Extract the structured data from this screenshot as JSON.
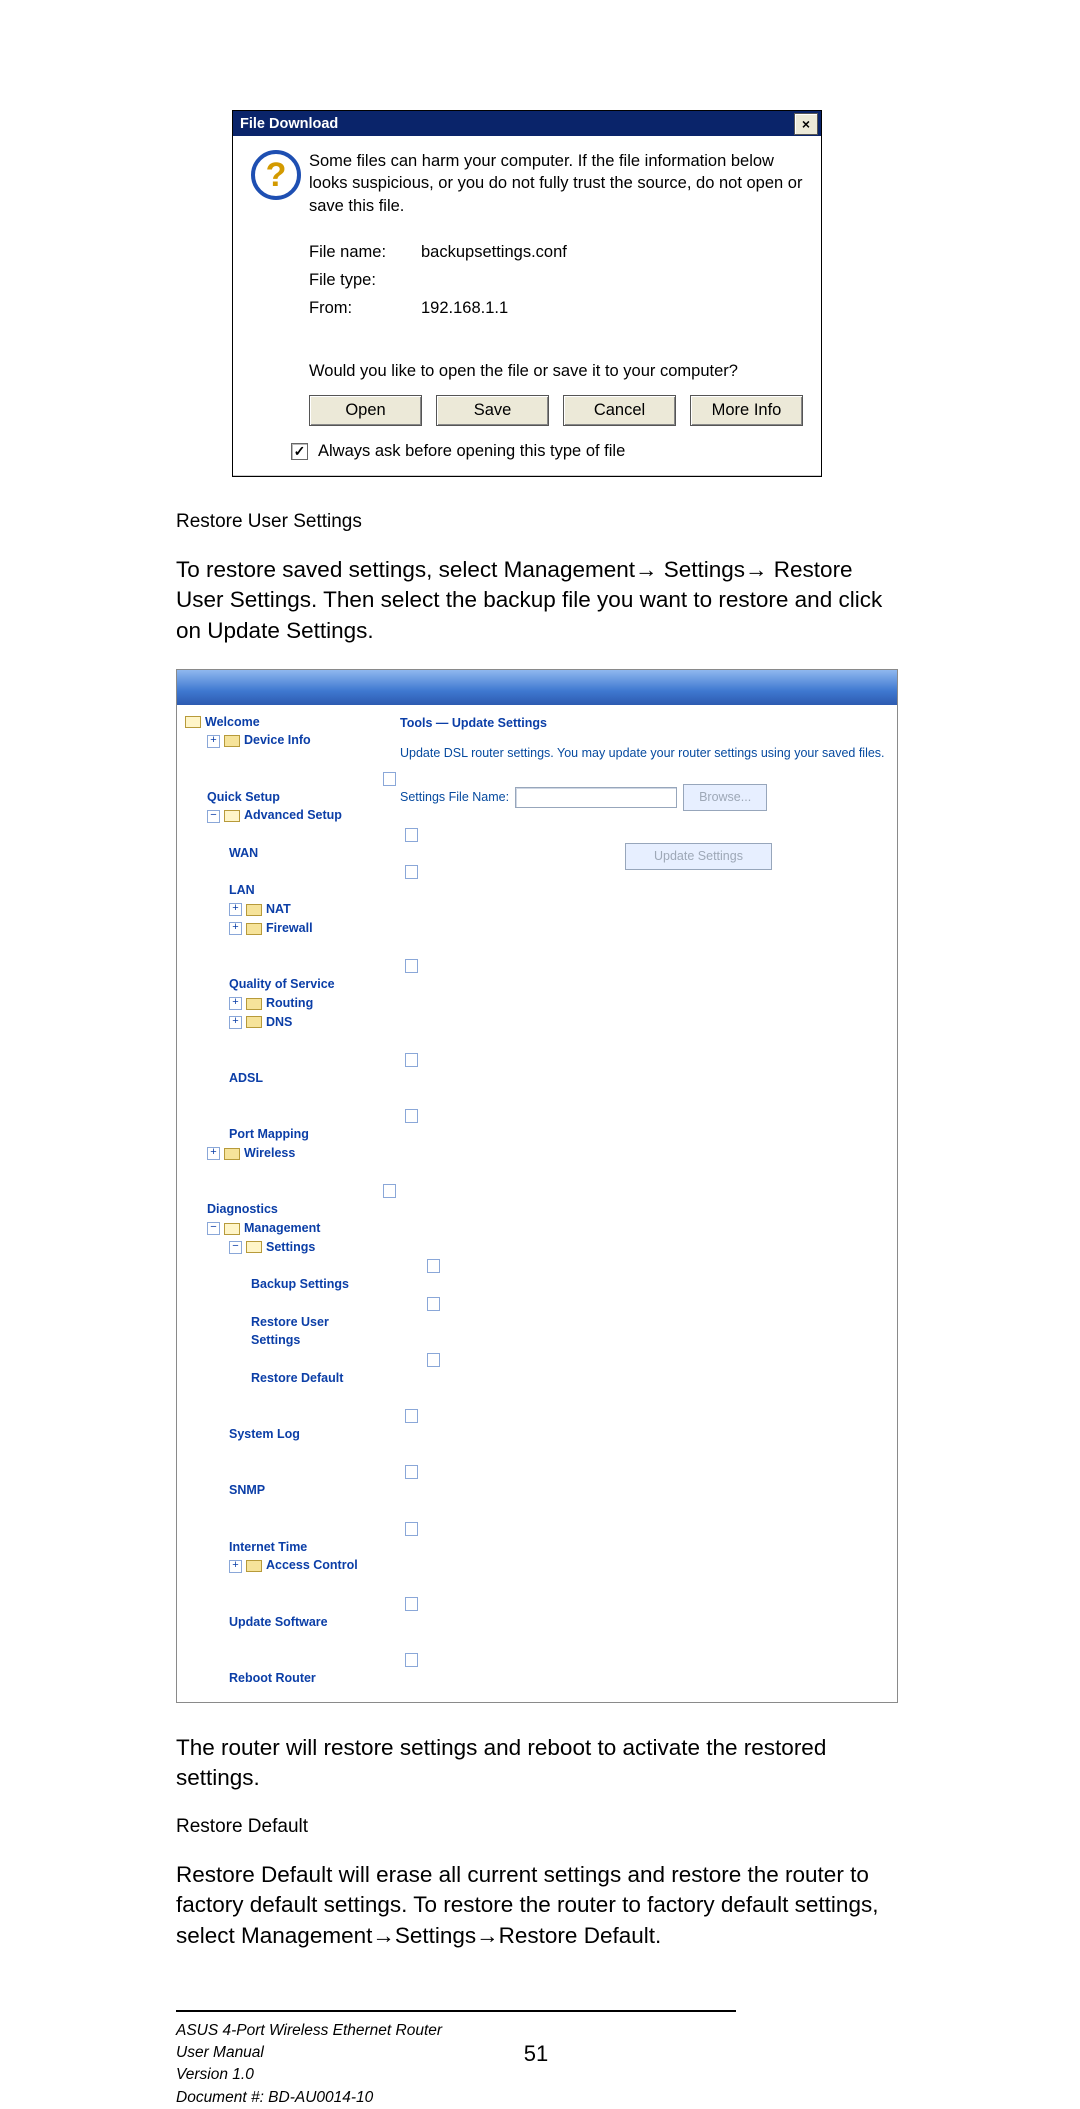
{
  "dialog": {
    "title": "File Download",
    "warning": "Some files can harm your computer. If the file information below looks suspicious, or you do not fully trust the source, do not open or save this file.",
    "filename_label": "File name:",
    "filename_value": "backupsettings.conf",
    "filetype_label": "File type:",
    "filetype_value": "",
    "from_label": "From:",
    "from_value": "192.168.1.1",
    "question": "Would you like to open the file or save it to your computer?",
    "btn_open": "Open",
    "btn_save": "Save",
    "btn_cancel": "Cancel",
    "btn_more": "More Info",
    "checkbox_label": "Always ask before opening this type of file"
  },
  "doc": {
    "restore_user_heading": "Restore User Settings",
    "restore_user_body_1": "To restore saved settings, select Management→ Settings→ Restore User Settings.  Then select the backup file you want to restore and click on ",
    "restore_user_body_2_bold": "Update Settings",
    "restore_user_body_3": ".",
    "after_router_body": "The router will restore settings and reboot to activate the restored settings.",
    "restore_default_heading": "Restore Default",
    "restore_default_body": "Restore Default will erase all current settings and restore the router to factory default settings. To restore the router to factory default settings, select Management→Settings→Restore Default.",
    "footer_line1": "ASUS 4-Port Wireless Ethernet Router",
    "footer_line2": "User Manual",
    "footer_line3": "Version 1.0",
    "footer_line4": "Document #:  BD-AU0014-10",
    "page_number": "51"
  },
  "router": {
    "title": "Tools — Update Settings",
    "desc": "Update DSL router settings. You may update your router settings using your saved files.",
    "settings_label": "Settings File Name:",
    "browse_btn": "Browse...",
    "update_btn": "Update Settings",
    "tree": {
      "welcome": "Welcome",
      "device_info": "Device Info",
      "quick_setup": "Quick Setup",
      "advanced_setup": "Advanced Setup",
      "wan": "WAN",
      "lan": "LAN",
      "nat": "NAT",
      "firewall": "Firewall",
      "qos": "Quality of Service",
      "routing": "Routing",
      "dns": "DNS",
      "adsl": "ADSL",
      "port_mapping": "Port Mapping",
      "wireless": "Wireless",
      "diagnostics": "Diagnostics",
      "management": "Management",
      "settings": "Settings",
      "backup_settings": "Backup Settings",
      "restore_user_settings": "Restore User Settings",
      "restore_default": "Restore Default",
      "system_log": "System Log",
      "snmp": "SNMP",
      "internet_time": "Internet Time",
      "access_control": "Access Control",
      "update_software": "Update Software",
      "reboot_router": "Reboot Router"
    }
  }
}
